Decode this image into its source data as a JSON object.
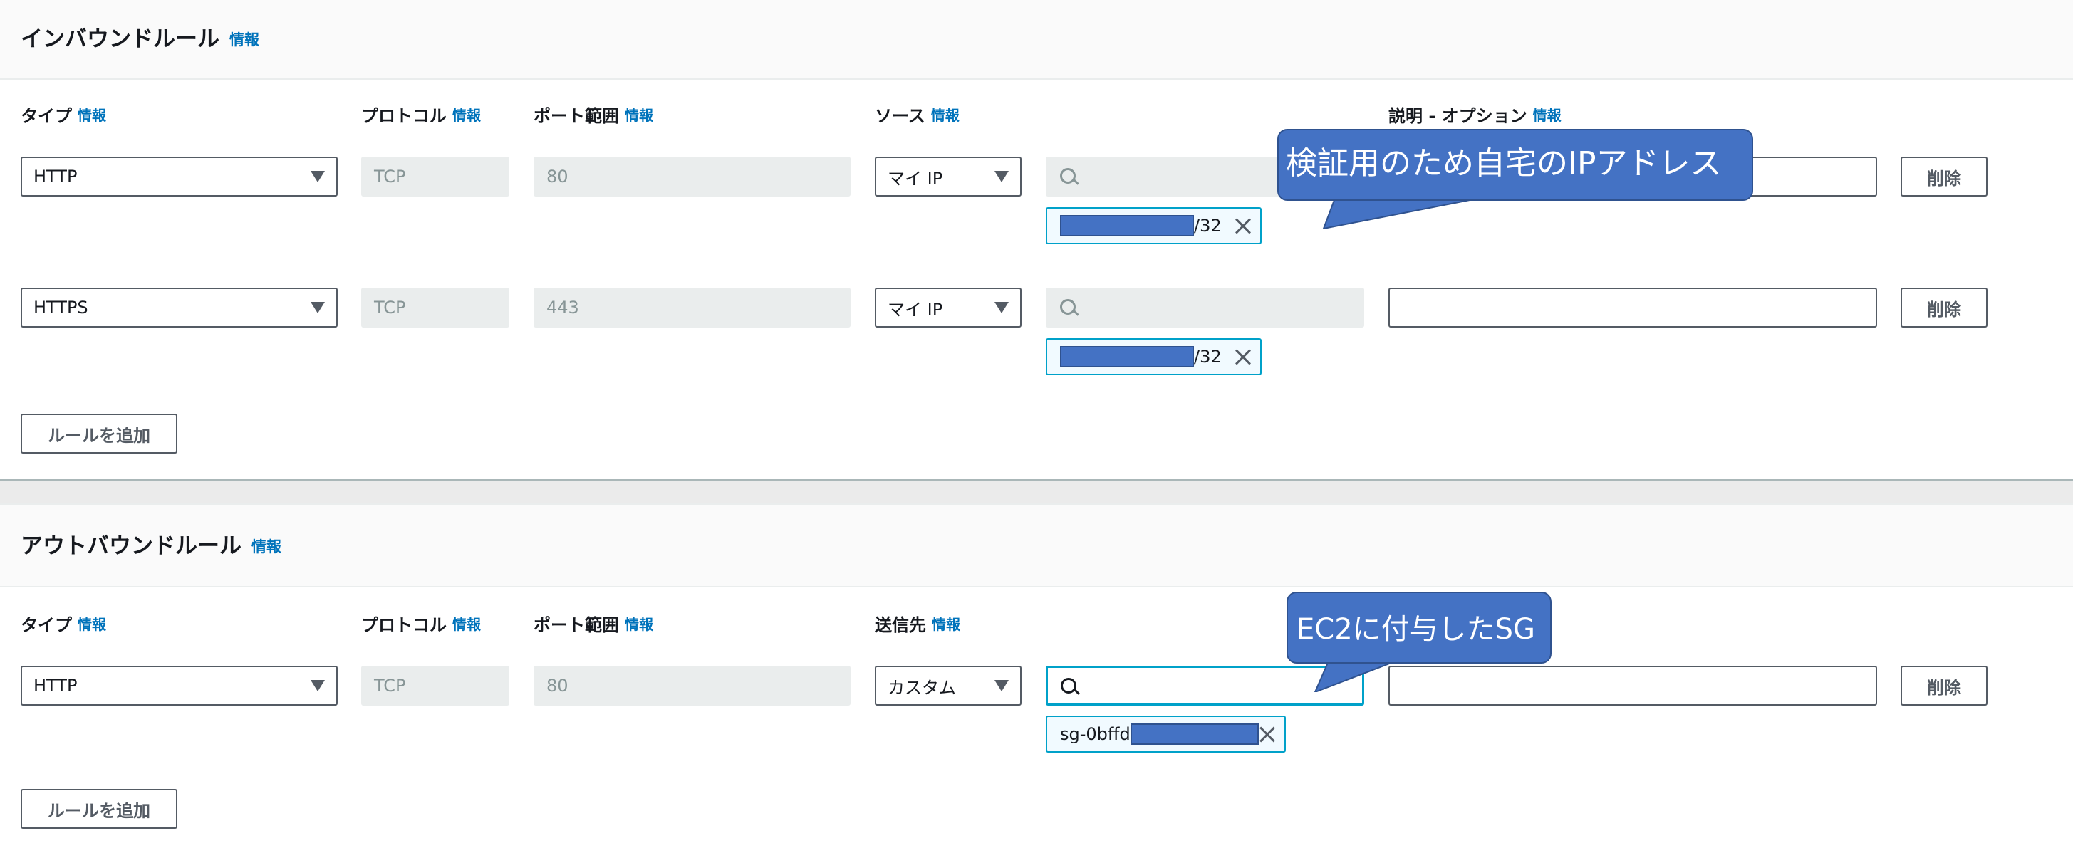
{
  "colors": {
    "accent_link": "#0073bb",
    "token_border": "#00a1c9",
    "callout_fill": "#4472c4",
    "callout_border": "#2f528f"
  },
  "inbound": {
    "title": "インバウンドルール",
    "info": "情報",
    "columns": {
      "type": "タイプ",
      "protocol": "プロトコル",
      "port": "ポート範囲",
      "source": "ソース",
      "description": "説明 - オプション"
    },
    "rules": [
      {
        "type": "HTTP",
        "protocol": "TCP",
        "port": "80",
        "source": "マイ IP",
        "cidr_suffix": "/32",
        "delete": "削除"
      },
      {
        "type": "HTTPS",
        "protocol": "TCP",
        "port": "443",
        "source": "マイ IP",
        "cidr_suffix": "/32",
        "delete": "削除"
      }
    ],
    "add_rule": "ルールを追加"
  },
  "outbound": {
    "title": "アウトバウンドルール",
    "info": "情報",
    "columns": {
      "type": "タイプ",
      "protocol": "プロトコル",
      "port": "ポート範囲",
      "destination": "送信先"
    },
    "rules": [
      {
        "type": "HTTP",
        "protocol": "TCP",
        "port": "80",
        "destination": "カスタム",
        "sg_prefix": "sg-0bffd",
        "delete": "削除"
      }
    ],
    "add_rule": "ルールを追加"
  },
  "callouts": {
    "inbound_note": "検証用のため自宅のIPアドレス",
    "outbound_note": "EC2に付与したSG"
  },
  "icons": {
    "search": "search-icon",
    "dropdown": "caret-down-icon",
    "remove": "close-icon"
  }
}
